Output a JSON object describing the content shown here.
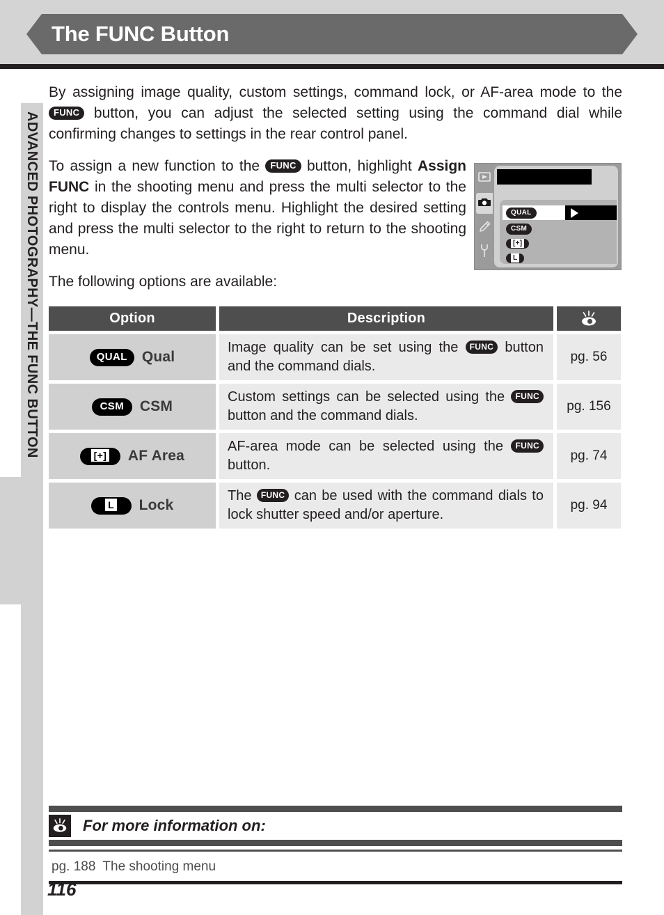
{
  "header": {
    "title": "The FUNC Button"
  },
  "sidebar": {
    "label": "ADVANCED PHOTOGRAPHY—THE FUNC BUTTON"
  },
  "body": {
    "para1_a": "By assigning image quality, custom settings, command lock, or AF-area mode to the ",
    "para1_func": "FUNC",
    "para1_b": " button, you can adjust the selected setting using the command dial while confirming changes to settings in the rear control panel.",
    "para2_a": "To assign a new function to the ",
    "para2_func": "FUNC",
    "para2_b": " button, highlight ",
    "para2_bold": "Assign FUNC",
    "para2_c": " in the shooting menu and press the multi selector to the right to display the controls menu.  Highlight the desired setting and press the multi selector to the right to return to the shooting menu.",
    "para3": "The following options are available:"
  },
  "lcd": {
    "tabs": [
      "playback-icon",
      "shooting-camera-icon",
      "pencil-icon",
      "wrench-icon"
    ],
    "menu_items": [
      {
        "badge": "QUAL",
        "selected": true,
        "arrow": "▶"
      },
      {
        "badge": "CSM",
        "selected": false
      },
      {
        "badge": "[+]",
        "selected": false
      },
      {
        "badge": "L",
        "selected": false
      }
    ]
  },
  "table": {
    "headers": {
      "option": "Option",
      "description": "Description",
      "reference": "eye-icon"
    },
    "rows": [
      {
        "badge": "QUAL",
        "badge_style": "plain",
        "label": "Qual",
        "desc_a": "Image quality can be set using the ",
        "desc_func": "FUNC",
        "desc_b": " button and the command dials.",
        "page": "pg. 56"
      },
      {
        "badge": "CSM",
        "badge_style": "plain",
        "label": "CSM",
        "desc_a": "Custom settings can be selected using the ",
        "desc_func": "FUNC",
        "desc_b": " button and the command dials.",
        "page": "pg. 156"
      },
      {
        "badge": "[+]",
        "badge_style": "boxed",
        "label": "AF Area",
        "desc_a": "AF-area mode can be selected using the ",
        "desc_func": "FUNC",
        "desc_b": " button.",
        "page": "pg. 74"
      },
      {
        "badge": "L",
        "badge_style": "boxed",
        "label": "Lock",
        "desc_a": "The ",
        "desc_func": "FUNC",
        "desc_b": " can  be used with the command dials to lock shutter speed and/or aperture.",
        "page": "pg. 94"
      }
    ]
  },
  "footer": {
    "heading": "For more information on:",
    "entry_page": "pg. 188",
    "entry_text": "The shooting menu",
    "page_number": "116"
  }
}
